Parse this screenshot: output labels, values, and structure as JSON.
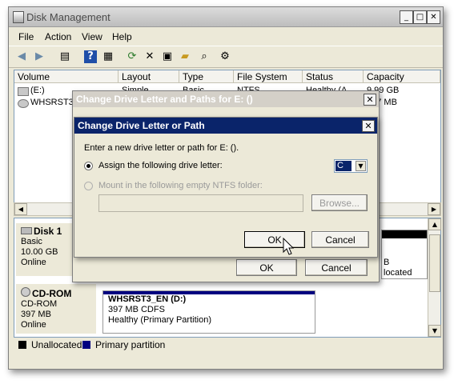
{
  "window": {
    "title": "Disk Management",
    "controls": [
      "_",
      "□",
      "✕"
    ]
  },
  "menu": [
    "File",
    "Action",
    "View",
    "Help"
  ],
  "toolbar_icons": [
    "back-icon",
    "forward-icon",
    "list-view-icon",
    "help-icon",
    "properties-icon",
    "refresh-icon",
    "delete-icon",
    "properties-sheet-icon",
    "open-folder-icon",
    "explore-icon",
    "settings-icon"
  ],
  "volume_list": {
    "columns": [
      "Volume",
      "Layout",
      "Type",
      "File System",
      "Status",
      "Capacity"
    ],
    "rows": [
      [
        "(E:)",
        "Simple",
        "Basic",
        "NTFS",
        "Healthy (A",
        "9.99 GB"
      ],
      [
        "WHSRST3_",
        "",
        "",
        "",
        "",
        "397 MB"
      ]
    ]
  },
  "disks": [
    {
      "name": "Disk 1",
      "type": "Basic",
      "size": "10.00 GB",
      "state": "Online",
      "partition_right": [
        "B",
        "located"
      ]
    },
    {
      "name": "CD-ROM",
      "type": "CD-ROM",
      "size": "397 MB",
      "state": "Online",
      "partition": {
        "name": "WHSRST3_EN  (D:)",
        "size_fs": "397 MB CDFS",
        "status": "Healthy (Primary Partition)"
      }
    }
  ],
  "legend": {
    "unallocated": "Unallocated",
    "primary": "Primary partition",
    "unallocated_color": "#000000",
    "primary_color": "#000080"
  },
  "outer_dialog": {
    "title": "Change Drive Letter and Paths for E: ()",
    "ok": "OK",
    "cancel": "Cancel"
  },
  "inner_dialog": {
    "title": "Change Drive Letter or Path",
    "prompt": "Enter a new drive letter or path for E: ().",
    "option_assign": "Assign the following drive letter:",
    "drive_letter": "C",
    "option_mount": "Mount in the following empty NTFS folder:",
    "browse": "Browse...",
    "ok": "OK",
    "cancel": "Cancel"
  },
  "colors": {
    "selection": "#0a246a",
    "inactive_title": "#d4d0c8"
  }
}
